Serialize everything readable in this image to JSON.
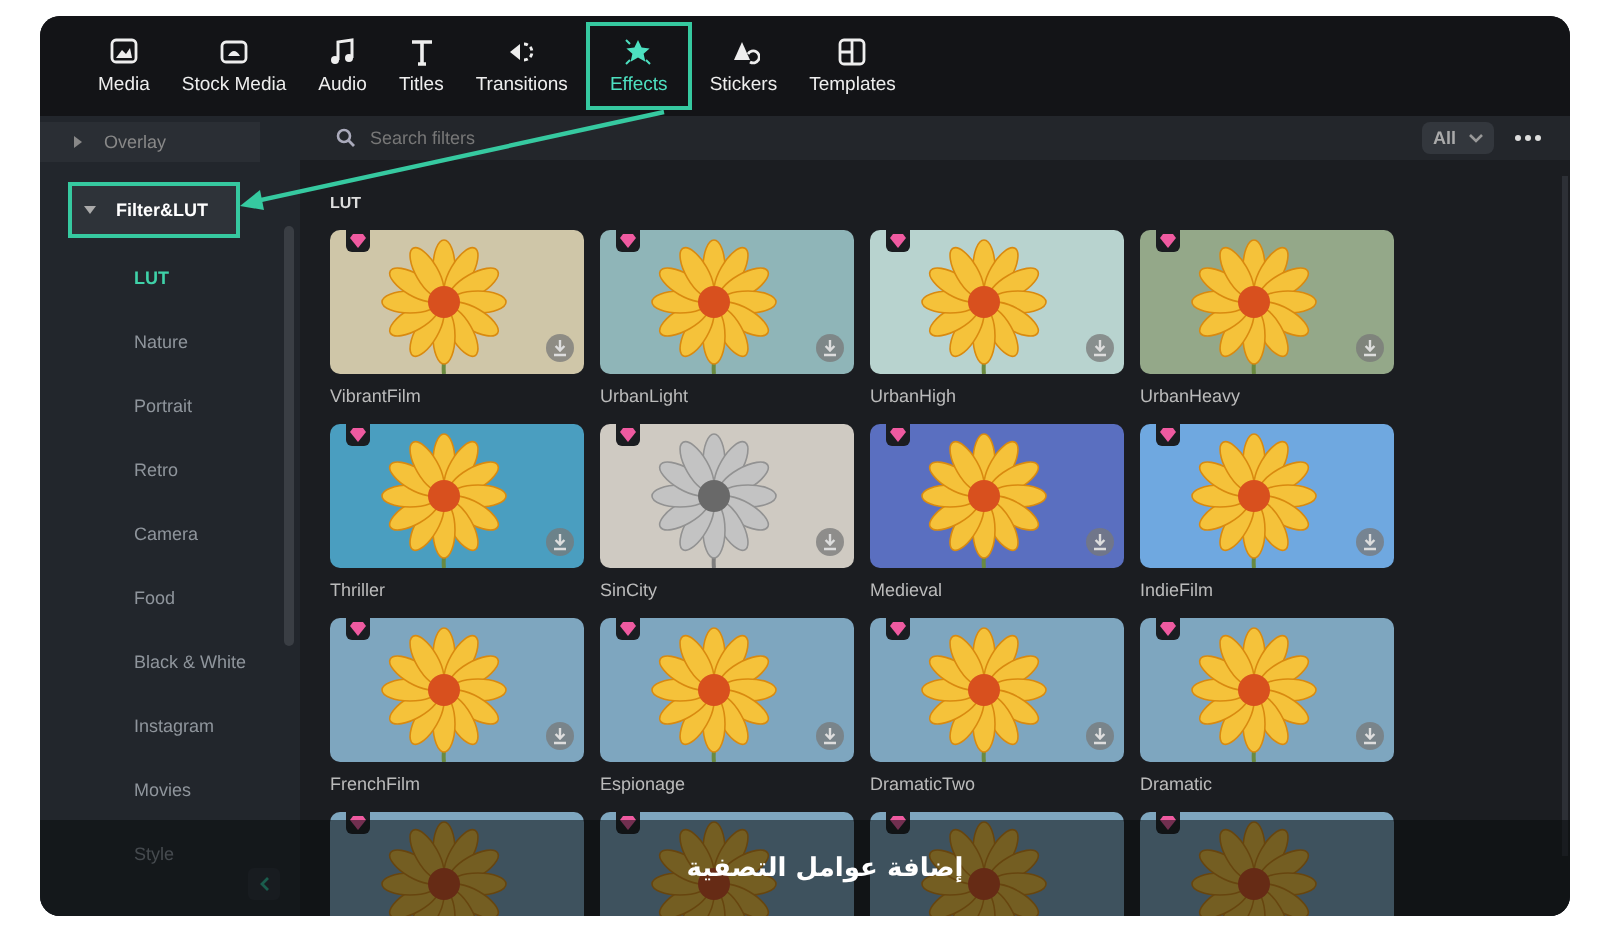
{
  "tabs": [
    {
      "label": "Media",
      "selected": false,
      "highlighted": false
    },
    {
      "label": "Stock Media",
      "selected": false,
      "highlighted": false
    },
    {
      "label": "Audio",
      "selected": false,
      "highlighted": false
    },
    {
      "label": "Titles",
      "selected": false,
      "highlighted": false
    },
    {
      "label": "Transitions",
      "selected": false,
      "highlighted": false
    },
    {
      "label": "Effects",
      "selected": true,
      "highlighted": true
    },
    {
      "label": "Stickers",
      "selected": false,
      "highlighted": false
    },
    {
      "label": "Templates",
      "selected": false,
      "highlighted": false
    }
  ],
  "sidebar": {
    "items": [
      {
        "label": "Overlay",
        "expanded": false,
        "highlighted": false
      },
      {
        "label": "Filter&LUT",
        "expanded": true,
        "highlighted": true,
        "children": [
          {
            "label": "LUT",
            "selected": true
          },
          {
            "label": "Nature",
            "selected": false
          },
          {
            "label": "Portrait",
            "selected": false
          },
          {
            "label": "Retro",
            "selected": false
          },
          {
            "label": "Camera",
            "selected": false
          },
          {
            "label": "Food",
            "selected": false
          },
          {
            "label": "Black & White",
            "selected": false
          },
          {
            "label": "Instagram",
            "selected": false
          },
          {
            "label": "Movies",
            "selected": false
          },
          {
            "label": "Style",
            "selected": false
          }
        ]
      }
    ]
  },
  "search": {
    "placeholder": "Search filters"
  },
  "filter_dropdown": {
    "value": "All"
  },
  "section_title": "LUT",
  "effects": [
    {
      "name": "VibrantFilm",
      "premium": true
    },
    {
      "name": "UrbanLight",
      "premium": true
    },
    {
      "name": "UrbanHigh",
      "premium": true
    },
    {
      "name": "UrbanHeavy",
      "premium": true
    },
    {
      "name": "Thriller",
      "premium": true
    },
    {
      "name": "SinCity",
      "premium": true
    },
    {
      "name": "Medieval",
      "premium": true
    },
    {
      "name": "IndieFilm",
      "premium": true
    },
    {
      "name": "FrenchFilm",
      "premium": true
    },
    {
      "name": "Espionage",
      "premium": true
    },
    {
      "name": "DramaticTwo",
      "premium": true
    },
    {
      "name": "Dramatic",
      "premium": true
    },
    {
      "premium": true
    },
    {
      "premium": true
    },
    {
      "premium": true
    },
    {
      "premium": true
    }
  ],
  "annotation": {
    "arrow": true,
    "caption": "إضافة عوامل التصفية"
  }
}
